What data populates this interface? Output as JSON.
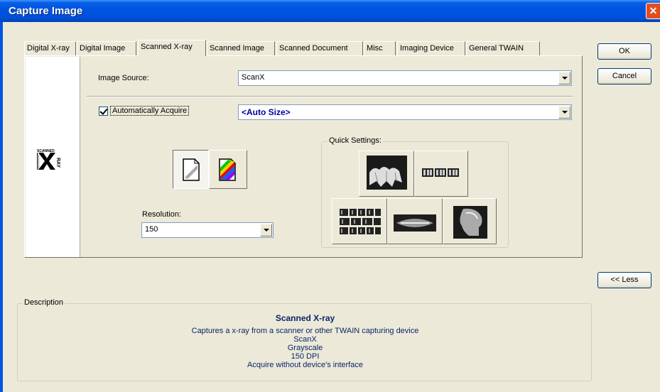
{
  "window": {
    "title": "Capture Image",
    "close_glyph": "✕"
  },
  "tabs": [
    {
      "label": "Digital X-ray"
    },
    {
      "label": "Digital Image"
    },
    {
      "label": "Scanned X-ray",
      "active": true
    },
    {
      "label": "Scanned Image"
    },
    {
      "label": "Scanned Document"
    },
    {
      "label": "Misc"
    },
    {
      "label": "Imaging Device"
    },
    {
      "label": "General TWAIN"
    }
  ],
  "panel": {
    "logo_text_top": "SCANNED",
    "logo_text_x": "X",
    "logo_text_side": "RAY",
    "image_source_label": "Image Source:",
    "image_source_value": "ScanX",
    "auto_acquire_label": "Automatically Acquire",
    "auto_acquire_checked": true,
    "size_value": "<Auto Size>",
    "resolution_label": "Resolution:",
    "resolution_value": "150",
    "quick_settings_label": "Quick Settings:"
  },
  "buttons": {
    "ok": "OK",
    "cancel": "Cancel",
    "less": "<< Less"
  },
  "description": {
    "legend": "Description",
    "title": "Scanned X-ray",
    "line1": "Captures a x-ray from a scanner or other TWAIN capturing device",
    "line2": "ScanX",
    "line3": "Grayscale",
    "line4": "150 DPI",
    "line5": "Acquire without device's interface"
  },
  "colors": {
    "accent": "#0054e3",
    "description_text": "#0a246a",
    "size_text": "#0000a0"
  }
}
